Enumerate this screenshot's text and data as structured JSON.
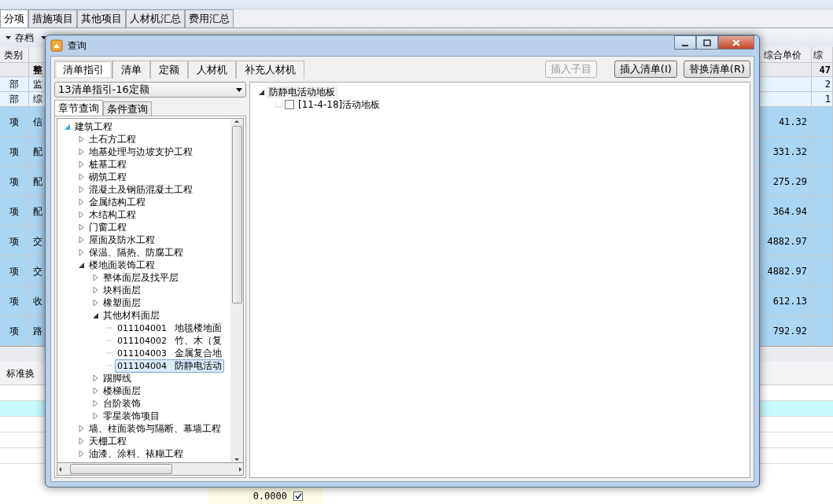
{
  "doc_tabs": [
    {
      "label": "分项",
      "selected": true
    },
    {
      "label": "措施项目",
      "selected": false
    },
    {
      "label": "其他项目",
      "selected": false
    },
    {
      "label": "人材机汇总",
      "selected": false
    },
    {
      "label": "费用汇总",
      "selected": false
    }
  ],
  "toolbar": {
    "save_label": "存档"
  },
  "grid": {
    "columns": [
      "类别",
      "综合单价",
      "综"
    ],
    "rows": [
      {
        "kind": "total",
        "type": "",
        "name": "整",
        "price": "",
        "total": "47"
      },
      {
        "kind": "section",
        "type": "部",
        "name": "监",
        "price": "",
        "total": "2"
      },
      {
        "kind": "section",
        "type": "部",
        "name": "综",
        "price": "",
        "total": "1"
      },
      {
        "kind": "item",
        "type": "项",
        "name": "信",
        "price": "41.32",
        "total": ""
      },
      {
        "kind": "item",
        "type": "项",
        "name": "配",
        "price": "331.32",
        "total": ""
      },
      {
        "kind": "item",
        "type": "项",
        "name": "配",
        "price": "275.29",
        "total": ""
      },
      {
        "kind": "item",
        "type": "项",
        "name": "配",
        "price": "364.94",
        "total": ""
      },
      {
        "kind": "item",
        "type": "项",
        "name": "交",
        "price": "4882.97",
        "total": ""
      },
      {
        "kind": "item",
        "type": "项",
        "name": "交",
        "price": "4882.97",
        "total": ""
      },
      {
        "kind": "item",
        "type": "项",
        "name": "收",
        "price": "612.13",
        "total": ""
      },
      {
        "kind": "item",
        "type": "项",
        "name": "路",
        "price": "792.92",
        "total": ""
      }
    ]
  },
  "lower": {
    "tab_label": "标准换",
    "value": "0.0000",
    "checked": true
  },
  "dialog": {
    "title": "查询",
    "tabs": [
      {
        "label": "清单指引",
        "selected": true
      },
      {
        "label": "清单",
        "selected": false
      },
      {
        "label": "定额",
        "selected": false
      },
      {
        "label": "人材机",
        "selected": false
      },
      {
        "label": "补充人材机",
        "selected": false
      }
    ],
    "buttons": [
      {
        "label": "插入子目",
        "disabled": true
      },
      {
        "label": "插入清单(I)",
        "disabled": false
      },
      {
        "label": "替换清单(R)",
        "disabled": false
      }
    ],
    "library": "13清单指引-16定额",
    "subtabs": [
      {
        "label": "章节查询",
        "selected": true
      },
      {
        "label": "条件查询",
        "selected": false
      }
    ],
    "tree": [
      {
        "label": "建筑工程",
        "expanded": true,
        "selected": false,
        "children": [
          {
            "label": "土石方工程",
            "expanded": false,
            "selected": false
          },
          {
            "label": "地基处理与边坡支护工程",
            "expanded": false,
            "selected": false
          },
          {
            "label": "桩基工程",
            "expanded": false,
            "selected": false
          },
          {
            "label": "砌筑工程",
            "expanded": false,
            "selected": false
          },
          {
            "label": "混凝土及钢筋混凝土工程",
            "expanded": false,
            "selected": false
          },
          {
            "label": "金属结构工程",
            "expanded": false,
            "selected": false
          },
          {
            "label": "木结构工程",
            "expanded": false,
            "selected": false
          },
          {
            "label": "门窗工程",
            "expanded": false,
            "selected": false
          },
          {
            "label": "屋面及防水工程",
            "expanded": false,
            "selected": false
          },
          {
            "label": "保温、隔热、防腐工程",
            "expanded": false,
            "selected": false
          },
          {
            "label": "楼地面装饰工程",
            "expanded": true,
            "selected": false,
            "children": [
              {
                "label": "整体面层及找平层",
                "expanded": false,
                "selected": false
              },
              {
                "label": "块料面层",
                "expanded": false,
                "selected": false
              },
              {
                "label": "橡塑面层",
                "expanded": false,
                "selected": false
              },
              {
                "label": "其他材料面层",
                "expanded": true,
                "selected": false,
                "children": [
                  {
                    "code": "011104001",
                    "label": "地毯楼地面",
                    "selected": false
                  },
                  {
                    "code": "011104002",
                    "label": "竹、木（复",
                    "selected": false
                  },
                  {
                    "code": "011104003",
                    "label": "金属复合地",
                    "selected": false
                  },
                  {
                    "code": "011104004",
                    "label": "防静电活动",
                    "selected": true
                  }
                ]
              },
              {
                "label": "踢脚线",
                "expanded": false,
                "selected": false
              },
              {
                "label": "楼梯面层",
                "expanded": false,
                "selected": false
              },
              {
                "label": "台阶装饰",
                "expanded": false,
                "selected": false
              },
              {
                "label": "零星装饰项目",
                "expanded": false,
                "selected": false
              }
            ]
          },
          {
            "label": "墙、柱面装饰与隔断、幕墙工程",
            "expanded": false,
            "selected": false
          },
          {
            "label": "天棚工程",
            "expanded": false,
            "selected": false
          },
          {
            "label": "油漆、涂料、裱糊工程",
            "expanded": false,
            "selected": false
          }
        ]
      }
    ],
    "result": {
      "label": "防静电活动地板",
      "expanded": true,
      "children": [
        {
          "label": "[11-4-18]活动地板",
          "checked": false
        }
      ]
    }
  }
}
